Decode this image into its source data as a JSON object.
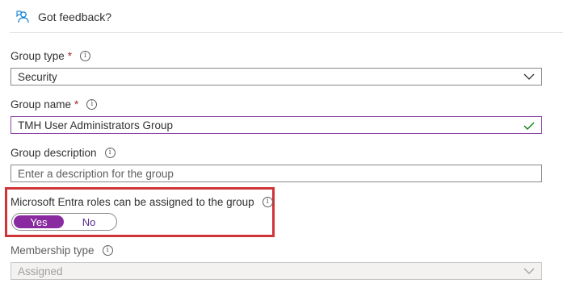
{
  "feedback": {
    "label": "Got feedback?"
  },
  "group_type": {
    "label": "Group type",
    "required": "*",
    "value": "Security"
  },
  "group_name": {
    "label": "Group name",
    "required": "*",
    "value": "TMH User Administrators Group"
  },
  "group_description": {
    "label": "Group description",
    "placeholder": "Enter a description for the group"
  },
  "entra_roles": {
    "label": "Microsoft Entra roles can be assigned to the group",
    "yes": "Yes",
    "no": "No",
    "selected": "Yes"
  },
  "membership_type": {
    "label": "Membership type",
    "value": "Assigned"
  },
  "colors": {
    "accent": "#8a2aa0",
    "highlight": "#d13438",
    "valid": "#107c10"
  }
}
